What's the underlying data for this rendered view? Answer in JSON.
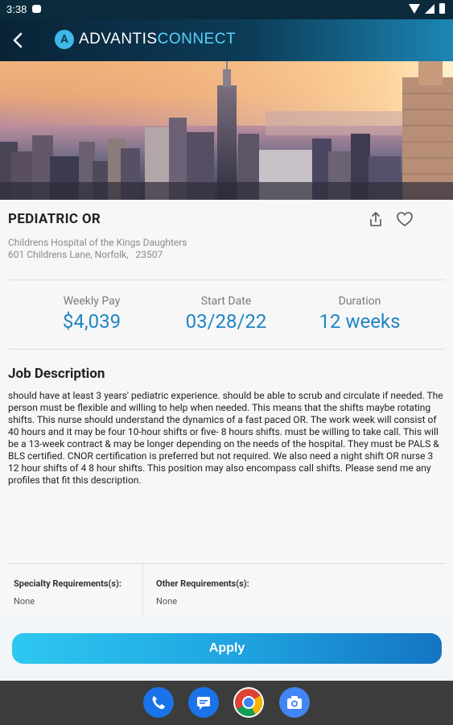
{
  "status_bar": {
    "time": "3:38"
  },
  "header": {
    "back_label": "Back",
    "logo_prefix": "ADVANTIS",
    "logo_suffix": "CONNECT",
    "logo_mark": "A"
  },
  "job": {
    "title": "PEDIATRIC OR",
    "hospital_name": "Childrens Hospital of the Kings Daughters",
    "address": "601 Childrens Lane, Norfolk,   23507"
  },
  "stats": [
    {
      "label": "Weekly Pay",
      "value": "$4,039"
    },
    {
      "label": "Start Date",
      "value": "03/28/22"
    },
    {
      "label": "Duration",
      "value": "12 weeks"
    }
  ],
  "description": {
    "heading": "Job Description",
    "text": "should have at least 3 years' pediatric experience.  should be able to scrub and circulate if needed. The person must be flexible and willing to help when needed. This means that the shifts maybe rotating shifts. This nurse should understand the dynamics of a fast paced OR. The work week will consist of 40 hours and it may be four 10-hour shifts or five- 8 hours shifts. must be willing to take call. This will be a 13-week contract & may be longer depending on the needs of the hospital. They must be PALS & BLS certified. CNOR certification is preferred but not required. We also need a night shift OR nurse 3 12 hour shifts of 4 8 hour shifts. This position may also encompass call shifts. Please send me any profiles that fit this description."
  },
  "requirements": {
    "specialty_label": "Specialty Requirements(s):",
    "specialty_value": "None",
    "other_label": "Other Requirements(s):",
    "other_value": "None"
  },
  "actions": {
    "apply_label": "Apply"
  },
  "dock": {
    "apps": [
      "phone-icon",
      "messages-icon",
      "chrome-icon",
      "camera-icon"
    ]
  },
  "colors": {
    "accent": "#1f86c4",
    "header_dark": "#0a2336",
    "apply_start": "#2ec8f0",
    "apply_end": "#1475c2"
  }
}
